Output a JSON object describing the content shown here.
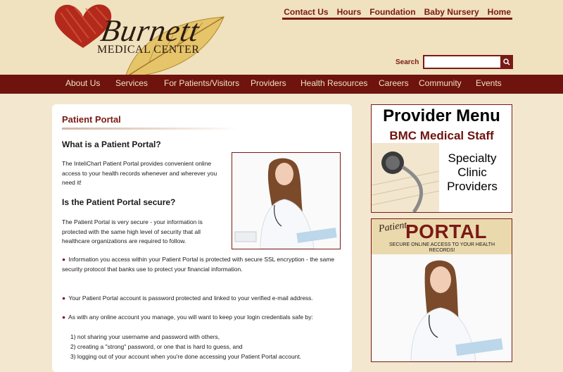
{
  "header": {
    "logo_text_main": "Burnett",
    "logo_text_sub": "Medical Center"
  },
  "top_links": [
    "Contact Us",
    "Hours",
    "Foundation",
    "Baby Nursery",
    "Home"
  ],
  "search": {
    "label": "Search",
    "placeholder": "",
    "value": "",
    "icon": "search-icon"
  },
  "nav": [
    "About Us",
    "Services",
    "For Patients/Visitors",
    "Providers",
    "Health Resources",
    "Careers",
    "Community",
    "Events"
  ],
  "main": {
    "title": "Patient Portal",
    "h_what": "What is a Patient Portal?",
    "p_what": "The InteliChart Patient Portal provides convenient online access to your health records whenever and wherever you need it!",
    "h_secure": "Is the Patient Portal secure?",
    "p_secure": "The Patient Portal is very secure - your information is protected with the same high level of security that all healthcare organizations are required to follow.",
    "bullet1": "Information you access within your Patient Portal is protected with secure SSL encryption - the same security protocol that banks use to protect your financial information.",
    "bullet2": "Your Patient Portal account is password protected and linked to your verified e-mail address.",
    "bullet3": "As with any online account you manage, you will want to keep your login credentials safe by:",
    "list": [
      "1) not sharing your username and password with others,",
      "2) creating a \"strong\" password, or one that is hard to guess, and",
      "3) logging out of your account when you're done accessing your Patient Portal account."
    ]
  },
  "provider_menu": {
    "title": "Provider Menu",
    "subtitle": "BMC Medical Staff",
    "lines": [
      "Specialty",
      "Clinic",
      "Providers"
    ]
  },
  "portal_ad": {
    "small": "Patient",
    "big": "PORTAL",
    "tagline": "SECURE ONLINE ACCESS TO YOUR HEALTH RECORDS!"
  },
  "colors": {
    "accent": "#7a1a14",
    "nav_bg": "#6e130e",
    "header_bg": "#f0e1bf",
    "page_bg": "#f3e7cf"
  }
}
